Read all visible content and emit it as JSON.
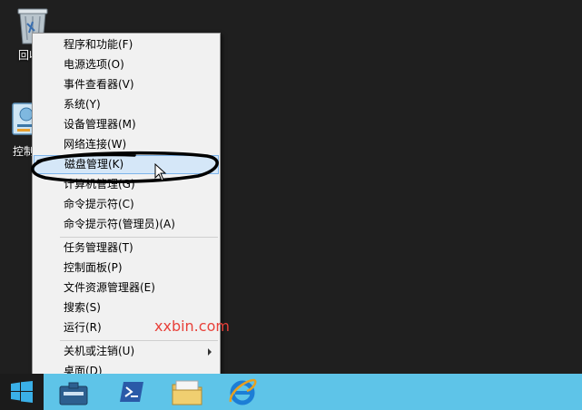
{
  "desktop": {
    "icons": [
      {
        "label": "回收站"
      },
      {
        "label": "控制面板"
      }
    ]
  },
  "menu": {
    "items": [
      {
        "label": "程序和功能(F)"
      },
      {
        "label": "电源选项(O)"
      },
      {
        "label": "事件查看器(V)"
      },
      {
        "label": "系统(Y)"
      },
      {
        "label": "设备管理器(M)"
      },
      {
        "label": "网络连接(W)"
      },
      {
        "label": "磁盘管理(K)",
        "highlighted": true
      },
      {
        "label": "计算机管理(G)"
      },
      {
        "label": "命令提示符(C)"
      },
      {
        "label": "命令提示符(管理员)(A)"
      },
      {
        "label": "任务管理器(T)"
      },
      {
        "label": "控制面板(P)"
      },
      {
        "label": "文件资源管理器(E)"
      },
      {
        "label": "搜索(S)"
      },
      {
        "label": "运行(R)"
      },
      {
        "label": "关机或注销(U)",
        "submenu": true
      },
      {
        "label": "桌面(D)"
      }
    ]
  },
  "watermark": "xxbin.com",
  "taskbar": {
    "apps": [
      "server-manager-icon",
      "powershell-icon",
      "file-explorer-icon",
      "internet-explorer-icon"
    ]
  },
  "colors": {
    "taskbar": "#5ec4e8",
    "menu_bg": "#f1f1f1",
    "highlight": "#d5e7f8",
    "watermark": "#e8413a"
  }
}
